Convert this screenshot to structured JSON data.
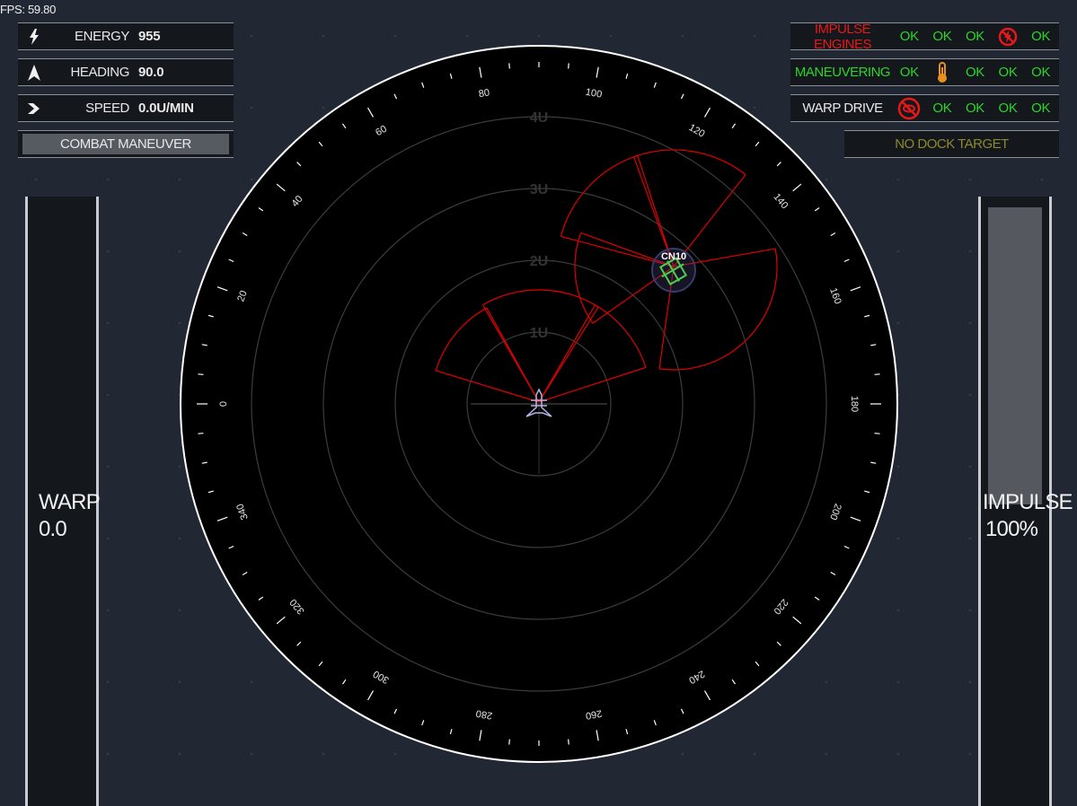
{
  "fps": "FPS: 59.80",
  "status": {
    "energy": {
      "icon": "lightning-icon",
      "label": "ENERGY",
      "value": "955"
    },
    "heading": {
      "icon": "arrow-up-icon",
      "label": "HEADING",
      "value": "90.0"
    },
    "speed": {
      "icon": "speed-icon",
      "label": "SPEED",
      "value": "0.0U/MIN"
    }
  },
  "combat_button": "COMBAT MANEUVER",
  "systems": [
    {
      "name": "IMPULSE ENGINES",
      "color": "#e81818",
      "cells": [
        "OK",
        "OK",
        "OK",
        "icon:no-power-icon",
        "OK"
      ]
    },
    {
      "name": "MANEUVERING",
      "color": "#2bd42b",
      "cells": [
        "OK",
        "icon:heat-icon",
        "OK",
        "OK",
        "OK"
      ]
    },
    {
      "name": "WARP DRIVE",
      "color": "#e8e8e8",
      "cells": [
        "icon:no-coolant-icon",
        "OK",
        "OK",
        "OK",
        "OK"
      ]
    }
  ],
  "dock_target": "NO DOCK TARGET",
  "warp": {
    "label": "WARP",
    "value": "0.0",
    "fill_fraction": 0.0
  },
  "impulse": {
    "label": "IMPULSE",
    "value": "100%",
    "fill_fraction": 1.0
  },
  "radar": {
    "range_labels": [
      "1U",
      "2U",
      "3U",
      "4U"
    ],
    "bearing_labels": [
      "0",
      "20",
      "40",
      "60",
      "80",
      "100",
      "120",
      "140",
      "160",
      "180",
      "200",
      "220",
      "240",
      "260",
      "280",
      "300",
      "320",
      "340"
    ],
    "target_callsign": "CN10",
    "colors": {
      "beam": "#e00000",
      "target": "#4ccf4c",
      "ship": "#b4b4e6",
      "ring": "#3c3c3c"
    }
  }
}
